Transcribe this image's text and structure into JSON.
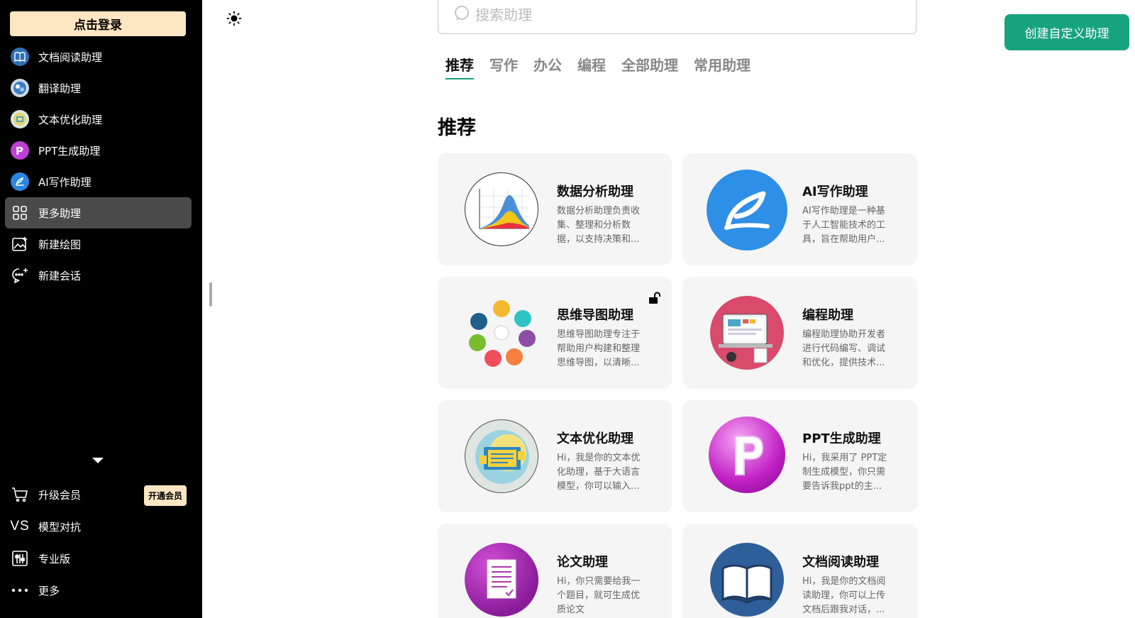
{
  "sidebar": {
    "login_label": "点击登录",
    "items": [
      {
        "label": "文档阅读助理",
        "icon": "book-icon",
        "active": false
      },
      {
        "label": "翻译助理",
        "icon": "translate-icon",
        "active": false
      },
      {
        "label": "文本优化助理",
        "icon": "text-optimize-icon",
        "active": false
      },
      {
        "label": "PPT生成助理",
        "icon": "ppt-icon",
        "active": false
      },
      {
        "label": "AI写作助理",
        "icon": "ai-writing-icon",
        "active": false
      },
      {
        "label": "更多助理",
        "icon": "grid-icon",
        "active": true
      },
      {
        "label": "新建绘图",
        "icon": "image-add-icon",
        "active": false
      },
      {
        "label": "新建会话",
        "icon": "chat-add-icon",
        "active": false
      }
    ],
    "bottom_items": [
      {
        "label": "升级会员",
        "icon": "cart-icon"
      },
      {
        "label": "模型对抗",
        "icon": "vs-icon",
        "icon_text": "VS"
      },
      {
        "label": "专业版",
        "icon": "sliders-icon"
      },
      {
        "label": "更多",
        "icon": "more-icon"
      }
    ],
    "vip_badge": "开通会员"
  },
  "search": {
    "placeholder": "搜索助理"
  },
  "create_button": "创建自定义助理",
  "tabs": [
    "推荐",
    "写作",
    "办公",
    "编程",
    "全部助理",
    "常用助理"
  ],
  "section_title": "推荐",
  "cards": [
    {
      "title": "数据分析助理",
      "desc": "数据分析助理负责收集、整理和分析数据，以支持决策和...",
      "icon": "data-analysis-icon"
    },
    {
      "title": "AI写作助理",
      "desc": "AI写作助理是一种基于人工智能技术的工具，旨在帮助用户...",
      "icon": "ai-writing-icon"
    },
    {
      "title": "思维导图助理",
      "desc": "思维导图助理专注于帮助用户构建和整理思维导图，以清晰...",
      "icon": "mind-map-icon",
      "locked": true
    },
    {
      "title": "编程助理",
      "desc": "编程助理协助开发者进行代码编写、调试和优化，提供技术...",
      "icon": "programming-icon"
    },
    {
      "title": "文本优化助理",
      "desc": "Hi，我是你的文本优化助理，基于大语言模型，你可以输入...",
      "icon": "text-optimize-icon"
    },
    {
      "title": "PPT生成助理",
      "desc": "Hi，我采用了 PPT定制生成模型，你只需要告诉我ppt的主...",
      "icon": "ppt-icon"
    },
    {
      "title": "论文助理",
      "desc": "Hi，你只需要给我一个题目，就可生成优质论文",
      "icon": "paper-icon"
    },
    {
      "title": "文档阅读助理",
      "desc": "Hi，我是你的文档阅读助理，你可以上传文档后跟我对话，...",
      "icon": "book-icon"
    }
  ],
  "colors": {
    "accent": "#17a37e",
    "login_bg": "#fde6c2",
    "sidebar_bg": "#000000",
    "card_bg": "#f5f5f5"
  }
}
